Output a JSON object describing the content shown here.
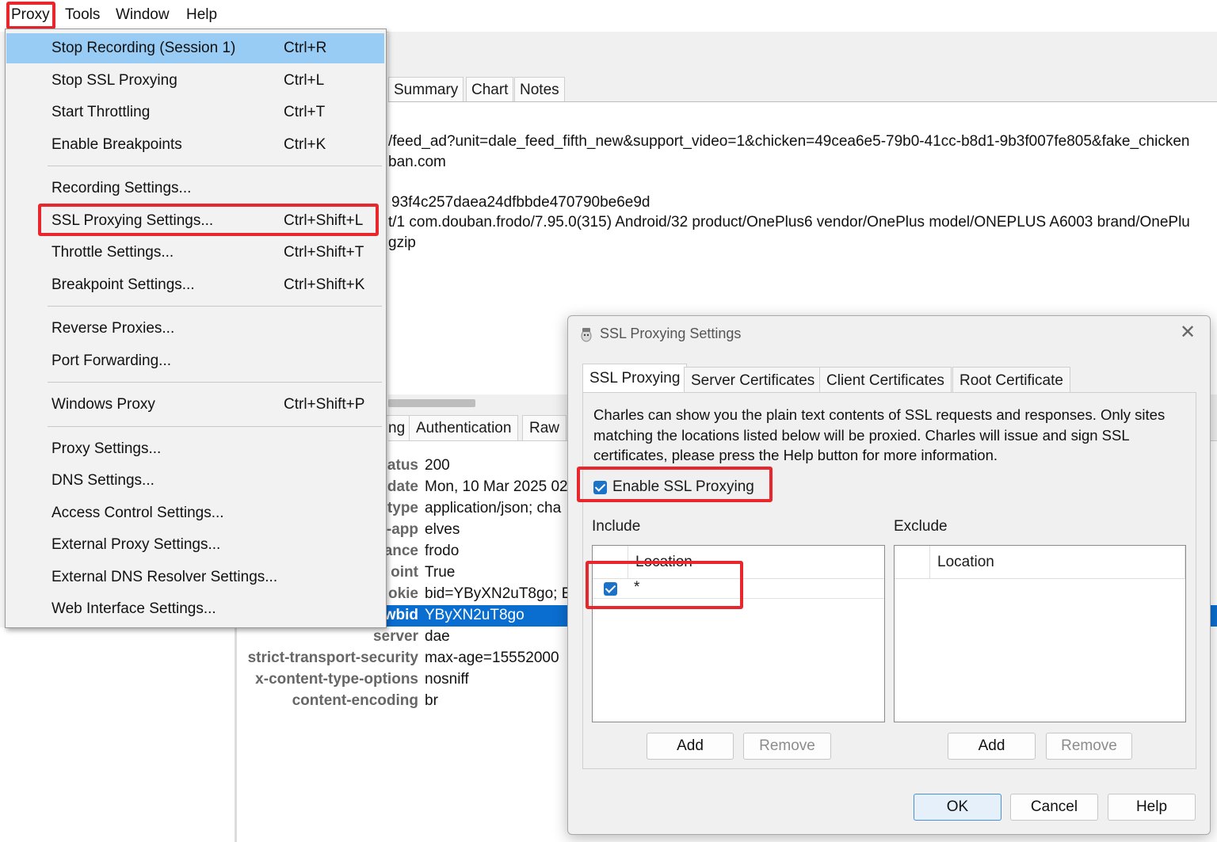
{
  "menubar": {
    "items": [
      "Proxy",
      "Tools",
      "Window",
      "Help"
    ]
  },
  "main_tabs": [
    "Summary",
    "Chart",
    "Notes"
  ],
  "request_lines": [
    "/feed_ad?unit=dale_feed_fifth_new&support_video=1&chicken=49cea6e5-79b0-41cc-b8d1-9b3f007fe805&fake_chicken",
    "ban.com",
    "93f4c257daea24dfbbde470790be6e9d",
    "t/1 com.douban.frodo/7.95.0(315) Android/32 product/OnePlus6 vendor/OnePlus model/ONEPLUS A6003 brand/OnePlu",
    "gzip"
  ],
  "sub_tabs": [
    "ng",
    "Authentication",
    "Raw"
  ],
  "headers": [
    {
      "key": "atus",
      "value": "200"
    },
    {
      "key": "date",
      "value": "Mon, 10 Mar 2025 02"
    },
    {
      "key": "type",
      "value": "application/json; cha"
    },
    {
      "key": "-app",
      "value": "elves"
    },
    {
      "key": "ance",
      "value": "frodo"
    },
    {
      "key": "oint",
      "value": "True"
    },
    {
      "key": "okie",
      "value": "bid=YByXN2uT8go; E"
    },
    {
      "key": "wbid",
      "value": "YByXN2uT8go"
    },
    {
      "key": "server",
      "value": "dae"
    },
    {
      "key": "strict-transport-security",
      "value": "max-age=15552000"
    },
    {
      "key": "x-content-type-options",
      "value": "nosniff"
    },
    {
      "key": "content-encoding",
      "value": "br"
    }
  ],
  "proxy_menu": {
    "items": [
      {
        "label": "Stop Recording (Session 1)",
        "shortcut": "Ctrl+R"
      },
      {
        "label": "Stop SSL Proxying",
        "shortcut": "Ctrl+L"
      },
      {
        "label": "Start Throttling",
        "shortcut": "Ctrl+T"
      },
      {
        "label": "Enable Breakpoints",
        "shortcut": "Ctrl+K"
      },
      {
        "label": "Recording Settings...",
        "shortcut": ""
      },
      {
        "label": "SSL Proxying Settings...",
        "shortcut": "Ctrl+Shift+L"
      },
      {
        "label": "Throttle Settings...",
        "shortcut": "Ctrl+Shift+T"
      },
      {
        "label": "Breakpoint Settings...",
        "shortcut": "Ctrl+Shift+K"
      },
      {
        "label": "Reverse Proxies...",
        "shortcut": ""
      },
      {
        "label": "Port Forwarding...",
        "shortcut": ""
      },
      {
        "label": "Windows Proxy",
        "shortcut": "Ctrl+Shift+P"
      },
      {
        "label": "Proxy Settings...",
        "shortcut": ""
      },
      {
        "label": "DNS Settings...",
        "shortcut": ""
      },
      {
        "label": "Access Control Settings...",
        "shortcut": ""
      },
      {
        "label": "External Proxy Settings...",
        "shortcut": ""
      },
      {
        "label": "External DNS Resolver Settings...",
        "shortcut": ""
      },
      {
        "label": "Web Interface Settings...",
        "shortcut": ""
      }
    ]
  },
  "dialog": {
    "title": "SSL Proxying Settings",
    "tabs": [
      "SSL Proxying",
      "Server Certificates",
      "Client Certificates",
      "Root Certificate"
    ],
    "description": "Charles can show you the plain text contents of SSL requests and responses. Only sites matching the locations listed below will be proxied. Charles will issue and sign SSL certificates, please press the Help button for more information.",
    "enable_label": "Enable SSL Proxying",
    "enable_checked": true,
    "include": {
      "label": "Include",
      "column": "Location",
      "rows": [
        {
          "checked": true,
          "location": "*"
        }
      ],
      "add": "Add",
      "remove": "Remove"
    },
    "exclude": {
      "label": "Exclude",
      "column": "Location",
      "add": "Add",
      "remove": "Remove"
    },
    "buttons": {
      "ok": "OK",
      "cancel": "Cancel",
      "help": "Help"
    }
  },
  "colors": {
    "highlight_red": "#e8262b",
    "selection_blue": "#0a6ed1",
    "menu_highlight": "#99ccf5"
  }
}
